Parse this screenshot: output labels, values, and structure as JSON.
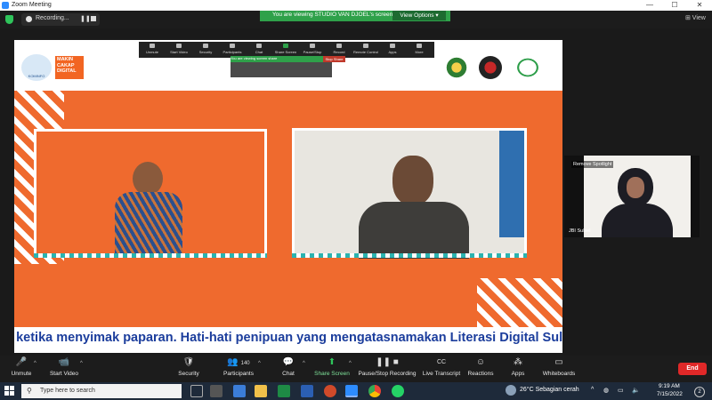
{
  "window": {
    "title": "Zoom Meeting",
    "controls": [
      "—",
      "☐",
      "✕"
    ]
  },
  "recording": {
    "status": "Recording...",
    "pause_glyph": "❚❚"
  },
  "share_banner": {
    "text": "You are viewing STUDIO VAN DJOEL's screen",
    "view_options": "View Options ▾"
  },
  "view_button": "⊞ View",
  "shared_screen": {
    "brand": {
      "logo_text": "KOMINFO",
      "campaign_lines": [
        "MAKIN",
        "CAKAP",
        "DIGITAL"
      ]
    },
    "partner_logos": [
      "partner-seal",
      "partner-shield",
      "partner-siberkreasi"
    ],
    "inner_toolbar": [
      "Unmute",
      "Start Video",
      "Security",
      "Participants",
      "Chat",
      "Share Screen",
      "Pause/Stop",
      "Record",
      "Remote Control",
      "Apps",
      "More"
    ],
    "inner_banner": "You are viewing screen share",
    "inner_stop": "Stop Share",
    "ticker": "a ketika menyimak paparan.   Hati-hati penipuan yang mengatasnamakan Literasi Digital Sul"
  },
  "speaker_panel": {
    "label": "Remove Spotlight",
    "name_tag": "JBI Sulsel"
  },
  "toolbar": {
    "items": [
      {
        "label": "Unmute",
        "icon": "🎤"
      },
      {
        "label": "Start Video",
        "icon": "📹"
      },
      {
        "label": "Security",
        "icon": "🛡"
      },
      {
        "label": "Participants",
        "icon": "👥",
        "count": "140"
      },
      {
        "label": "Chat",
        "icon": "💬"
      },
      {
        "label": "Share Screen",
        "icon": "⬆"
      },
      {
        "label": "Pause/Stop Recording",
        "icon": "❚❚ ■"
      },
      {
        "label": "Live Transcript",
        "icon": "CC"
      },
      {
        "label": "Reactions",
        "icon": "☺"
      },
      {
        "label": "Apps",
        "icon": "⁂"
      },
      {
        "label": "Whiteboards",
        "icon": "▭"
      }
    ],
    "end": "End"
  },
  "taskbar": {
    "search_placeholder": "Type here to search",
    "weather": "26°C  Sebagian cerah",
    "time": "9:19 AM",
    "date": "7/15/2022",
    "notification_count": "2"
  },
  "colors": {
    "accent": "#ef6a2e",
    "zoom_blue": "#2d8cff",
    "share_green": "#2fa14a",
    "end_red": "#e02828",
    "ticker_blue": "#1b3d9c"
  }
}
